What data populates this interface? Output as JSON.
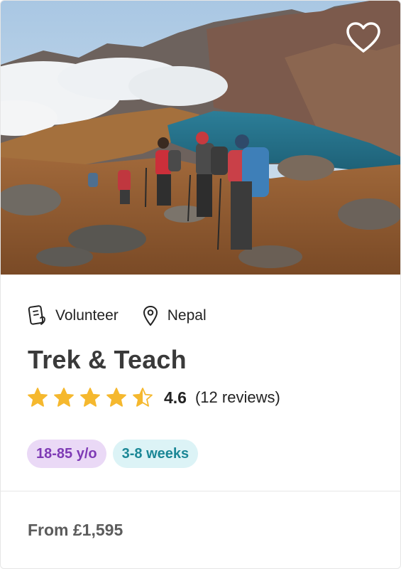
{
  "card": {
    "favorite_icon": "heart-outline-icon",
    "category": {
      "icon": "volunteer-card-icon",
      "label": "Volunteer"
    },
    "location": {
      "icon": "map-pin-icon",
      "label": "Nepal"
    },
    "title": "Trek & Teach",
    "rating": {
      "stars": 4.5,
      "max_stars": 5,
      "value": "4.6",
      "count_text": "(12 reviews)",
      "star_color": "#f5b82e"
    },
    "tags": [
      {
        "label": "18-85 y/o",
        "bg": "#ead9f6",
        "color": "#7e3ab5"
      },
      {
        "label": "3-8 weeks",
        "bg": "#dcf3f6",
        "color": "#1b8796"
      }
    ],
    "price_text": "From £1,595"
  }
}
